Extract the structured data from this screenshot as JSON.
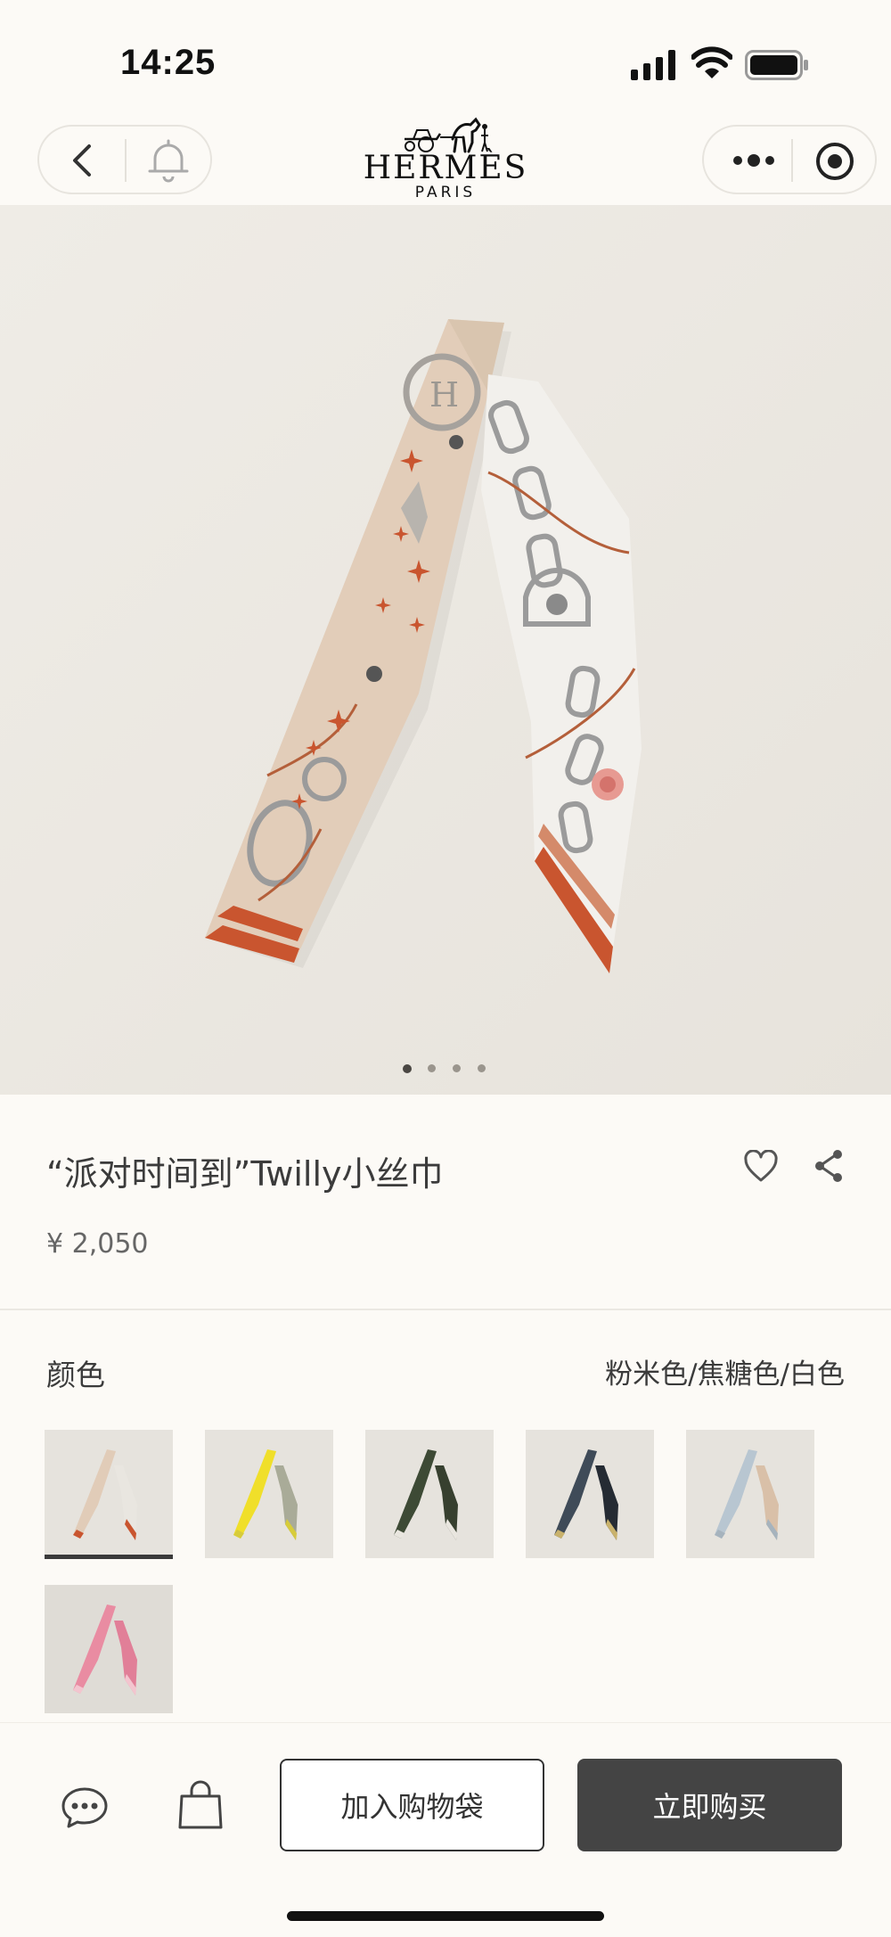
{
  "status_bar": {
    "time": "14:25"
  },
  "nav": {
    "brand": "HERMÈS",
    "city": "PARIS"
  },
  "gallery": {
    "current_index": 1,
    "total": 4
  },
  "product": {
    "title": "“派对时间到”Twilly小丝巾",
    "price": "¥ 2,050"
  },
  "color": {
    "label": "颜色",
    "selected_value": "粉米色/焦糖色/白色",
    "swatches": [
      {
        "left": "#e1ccb8",
        "right": "#e9e6e0",
        "accent": "#c9552f",
        "bg": "#e6e3dd",
        "selected": true
      },
      {
        "left": "#f0df2a",
        "right": "#a9ab98",
        "accent": "#d7cc3a",
        "bg": "#e6e3dd",
        "selected": false
      },
      {
        "left": "#3d4a35",
        "right": "#37402f",
        "accent": "#e9e6df",
        "bg": "#e6e3dd",
        "selected": false
      },
      {
        "left": "#3f4b58",
        "right": "#252b33",
        "accent": "#c9b26c",
        "bg": "#e6e3dd",
        "selected": false
      },
      {
        "left": "#b8c6d1",
        "right": "#d9c0a8",
        "accent": "#a6b3bd",
        "bg": "#e6e3dd",
        "selected": false
      },
      {
        "left": "#e98ca2",
        "right": "#e17f98",
        "accent": "#f3c5cf",
        "bg": "#dfdcd6",
        "selected": false
      }
    ]
  },
  "actions": {
    "add_to_bag": "加入购物袋",
    "buy_now": "立即购买"
  }
}
